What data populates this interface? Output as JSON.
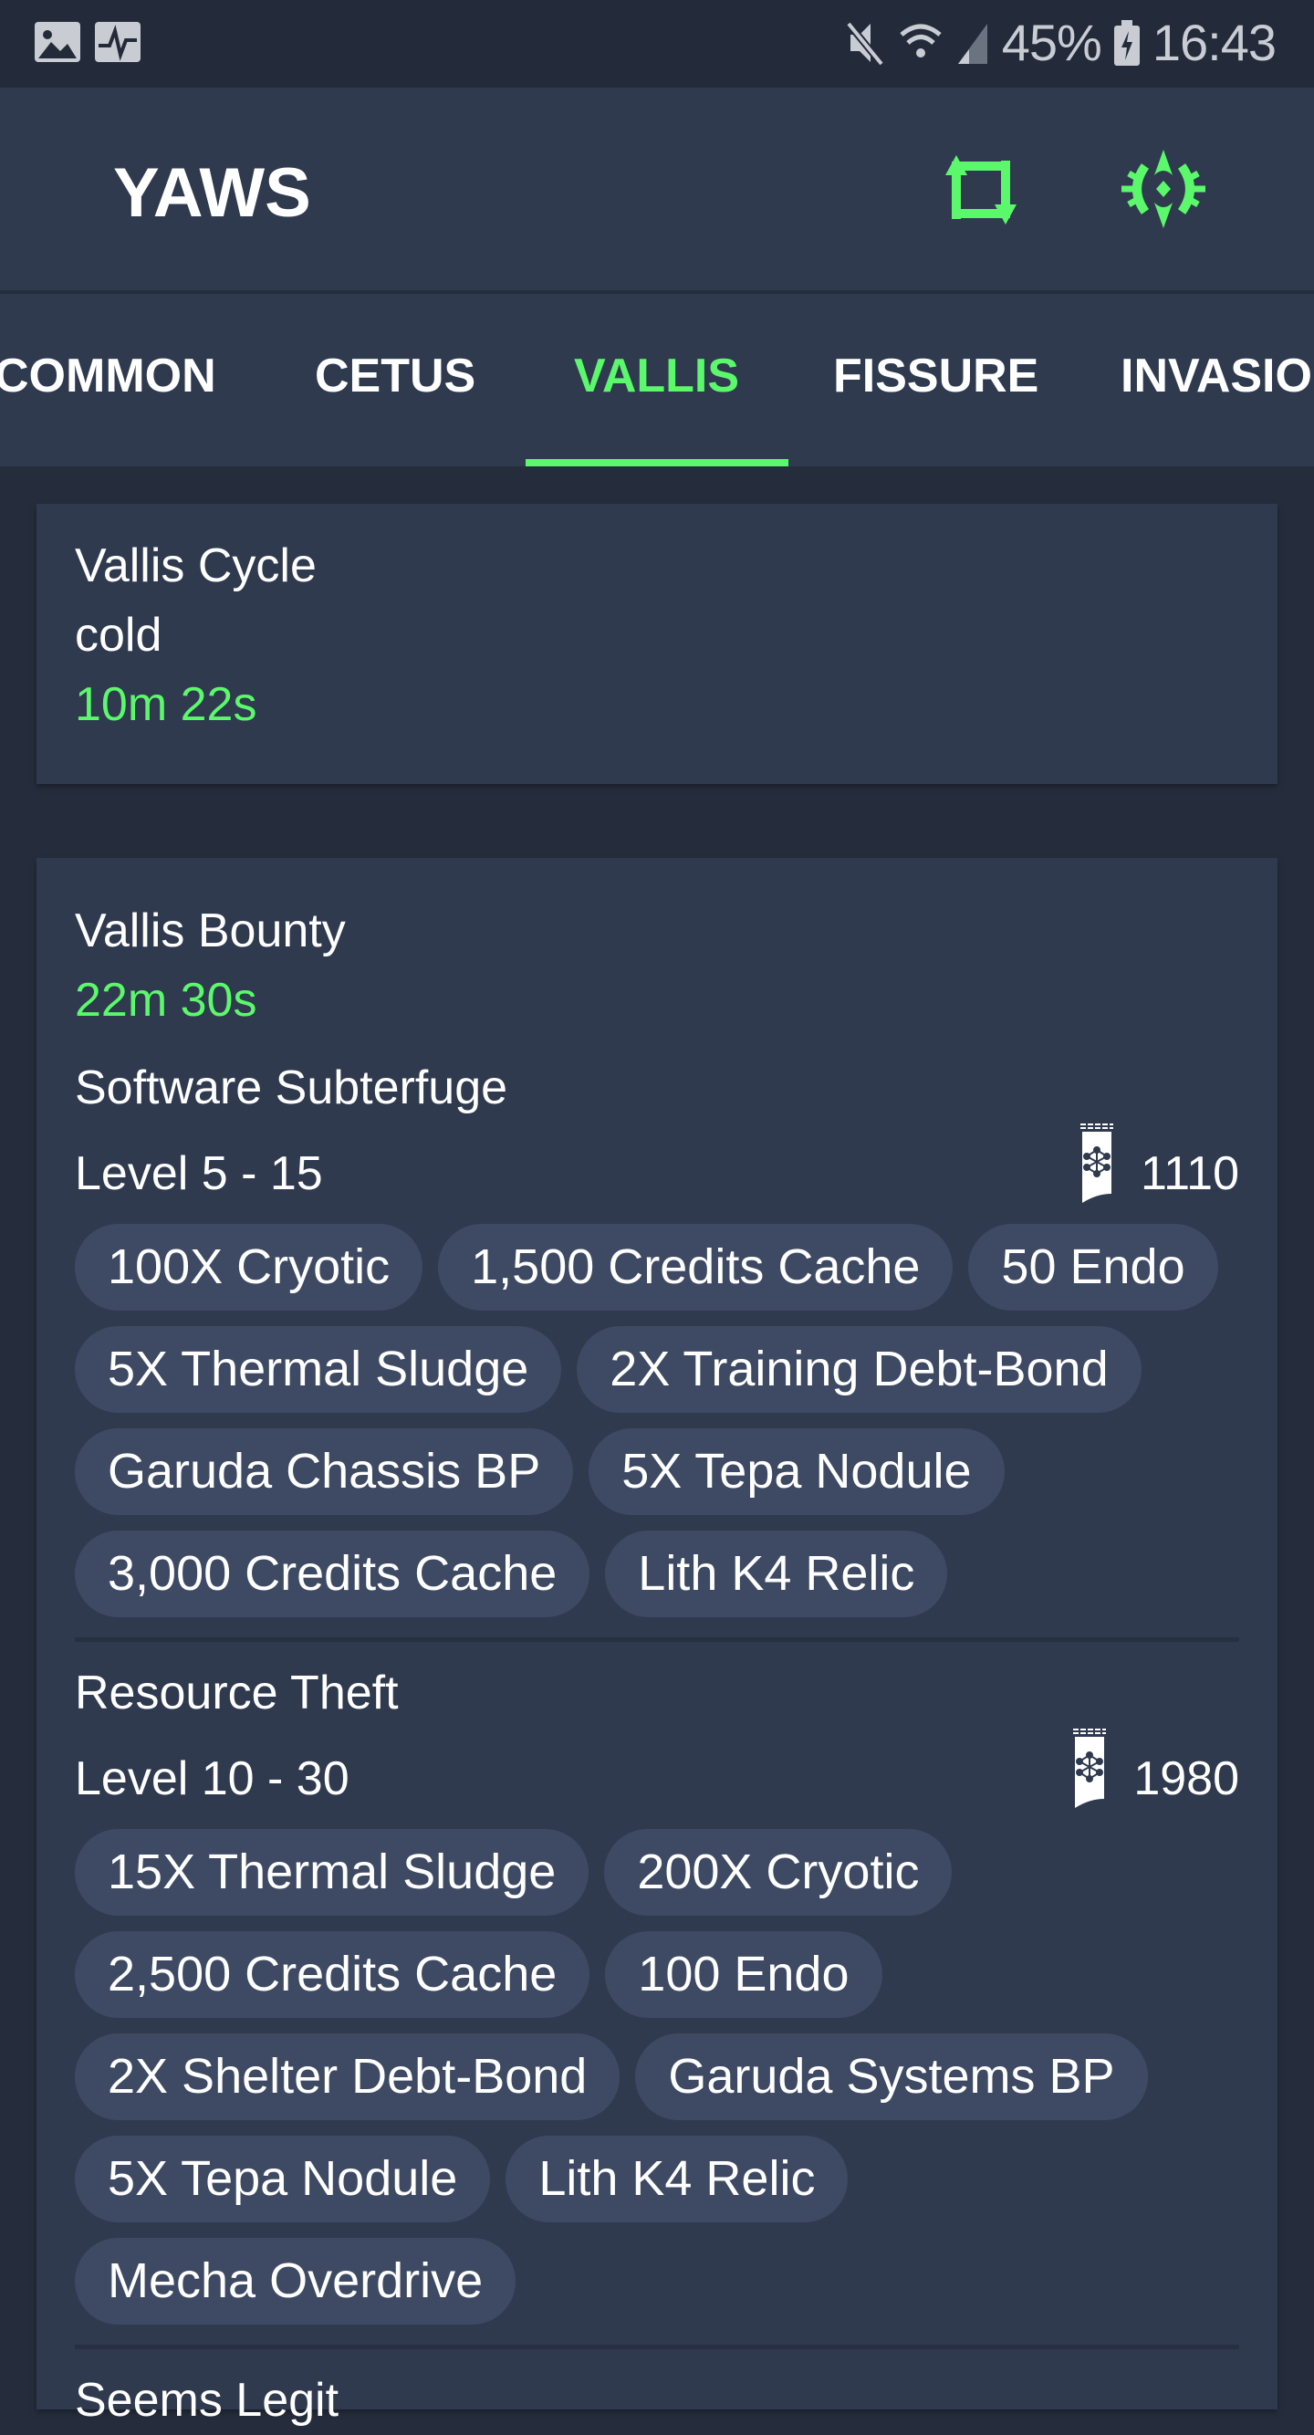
{
  "status_bar": {
    "battery": "45%",
    "time": "16:43",
    "icons": [
      "gallery-icon",
      "activity-icon",
      "mute-icon",
      "wifi-icon",
      "signal-icon",
      "battery-charging-icon"
    ]
  },
  "app_bar": {
    "title": "YAWS",
    "actions": [
      "refresh-icon",
      "settings-emblem-icon"
    ],
    "accent": "#5cf86c"
  },
  "tabs": [
    {
      "label": "COMMON"
    },
    {
      "label": "CETUS"
    },
    {
      "label": "VALLIS",
      "active": true
    },
    {
      "label": "FISSURE"
    },
    {
      "label": "INVASIO"
    }
  ],
  "cycle": {
    "title": "Vallis Cycle",
    "state": "cold",
    "time": "10m 22s"
  },
  "bounty": {
    "title": "Vallis Bounty",
    "time": "22m 30s",
    "jobs": [
      {
        "name": "Software Subterfuge",
        "level": "Level 5 - 15",
        "standing": "1110",
        "rewards": [
          "100X Cryotic",
          "1,500 Credits Cache",
          "50 Endo",
          "5X Thermal Sludge",
          "2X Training Debt-Bond",
          "Garuda Chassis BP",
          "5X Tepa Nodule",
          "3,000 Credits Cache",
          "Lith K4 Relic"
        ]
      },
      {
        "name": "Resource Theft",
        "level": "Level 10 - 30",
        "standing": "1980",
        "rewards": [
          "15X Thermal Sludge",
          "200X Cryotic",
          "2,500 Credits Cache",
          "100 Endo",
          "2X Shelter Debt-Bond",
          "Garuda Systems BP",
          "5X Tepa Nodule",
          "Lith K4 Relic",
          "Mecha Overdrive"
        ]
      },
      {
        "name": "Seems Legit"
      }
    ]
  }
}
